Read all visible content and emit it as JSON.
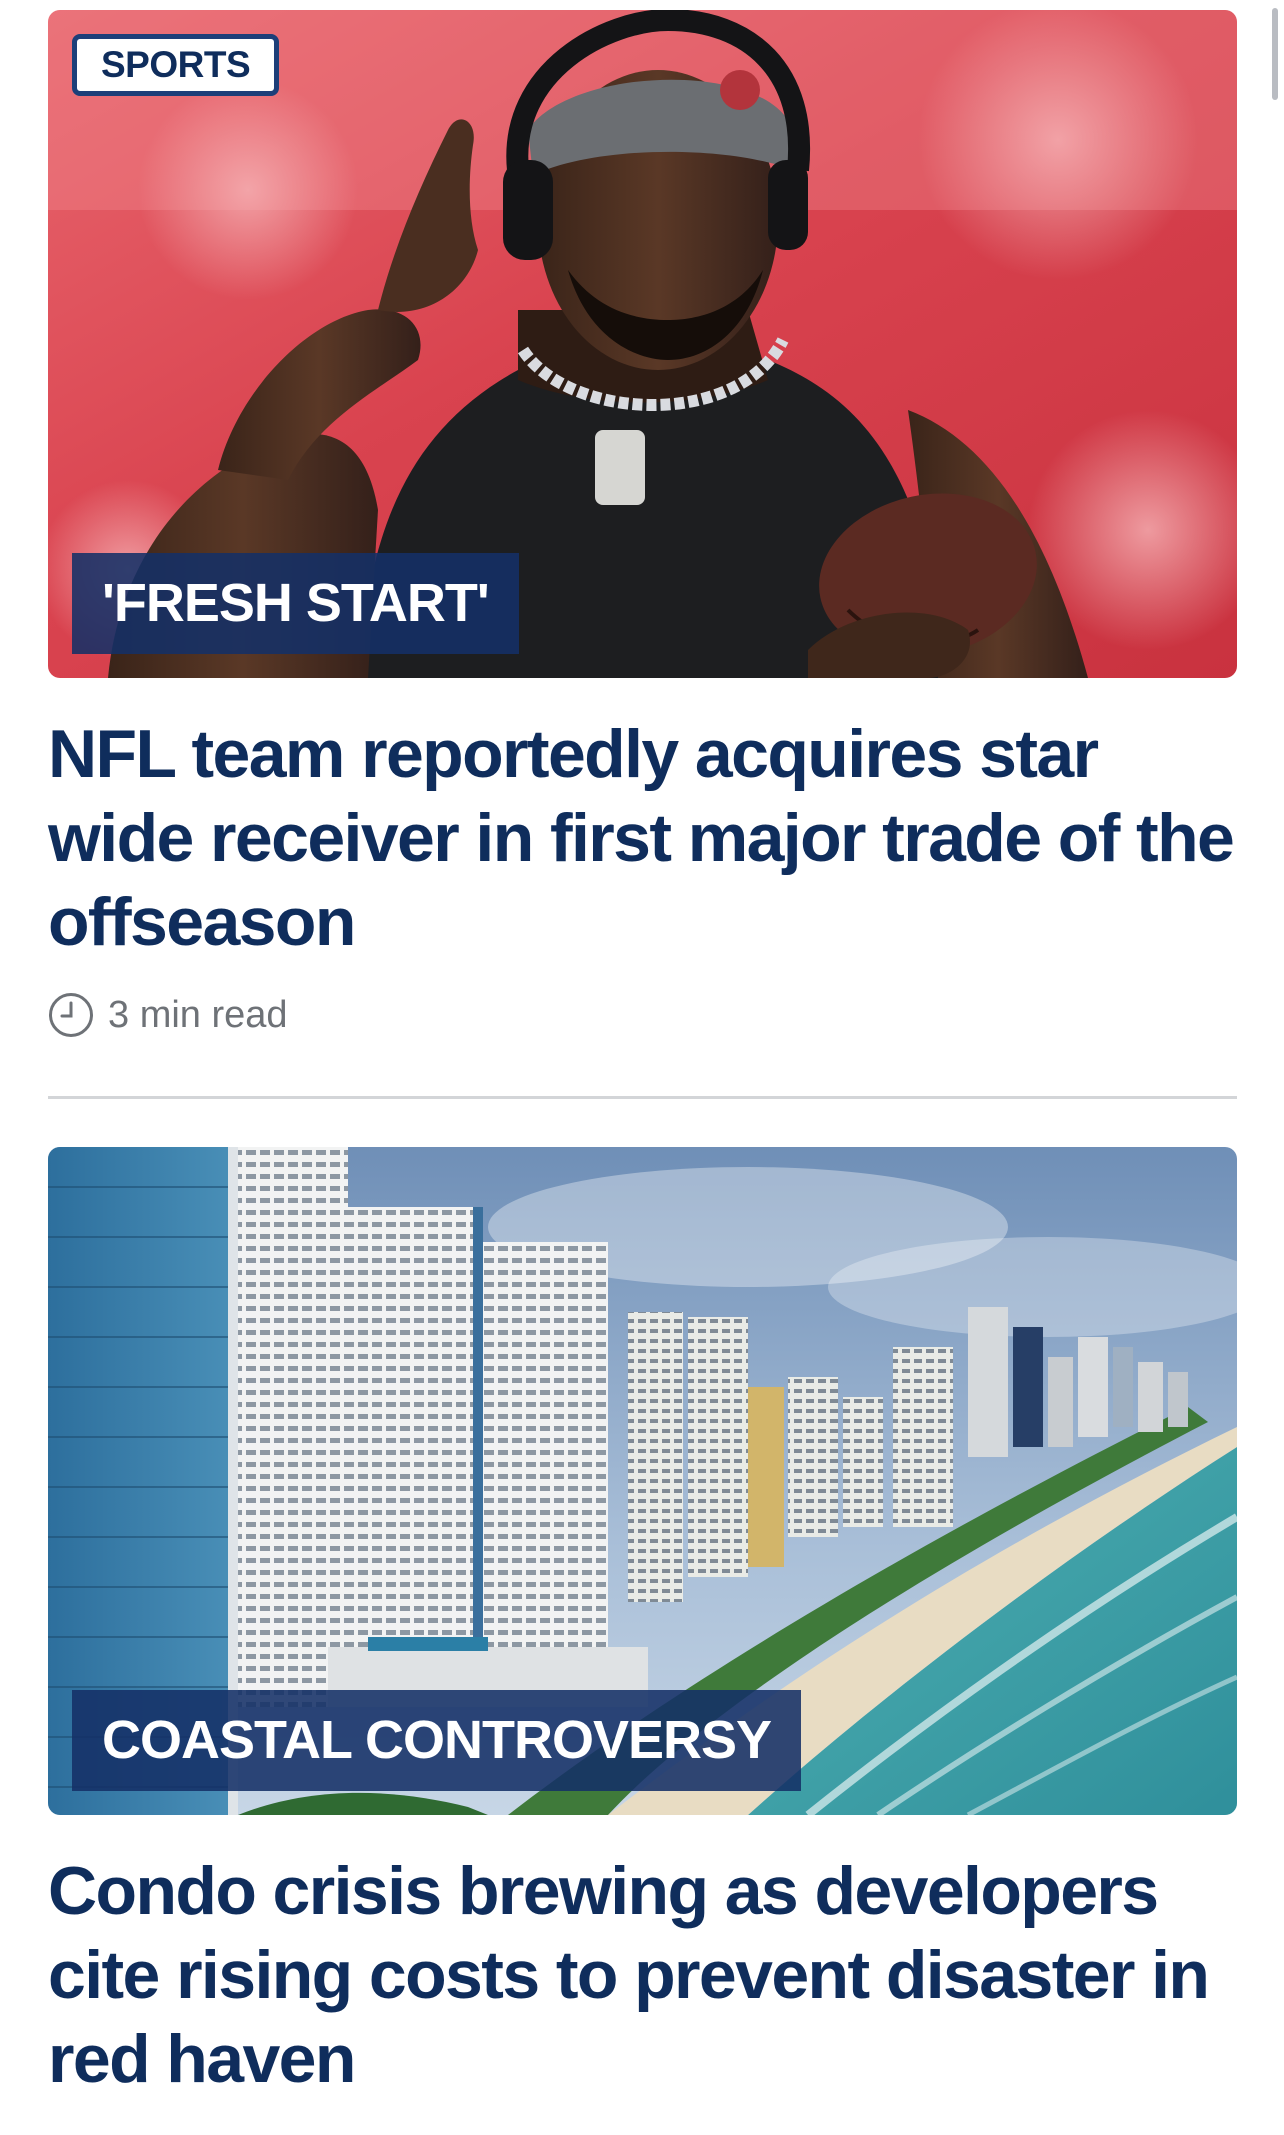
{
  "feed": {
    "articles": [
      {
        "section": "SPORTS",
        "kicker": "'FRESH START'",
        "headline": "NFL team reportedly acquires star wide receiver in first major trade of the offseason",
        "read_time": "3 min read",
        "image": "football-player-photo"
      },
      {
        "section": "",
        "kicker": "COASTAL CONTROVERSY",
        "headline": "Condo crisis brewing as developers cite rising costs to prevent disaster in red haven",
        "read_time": "",
        "image": "beachfront-condos-photo"
      }
    ]
  },
  "colors": {
    "headline": "#0f2d5c",
    "kicker_background": "#143066",
    "badge_border": "#1d3f79",
    "meta_text": "#6e7277",
    "divider": "#d3d5d8"
  },
  "icons": {
    "read_time": "clock-icon"
  }
}
